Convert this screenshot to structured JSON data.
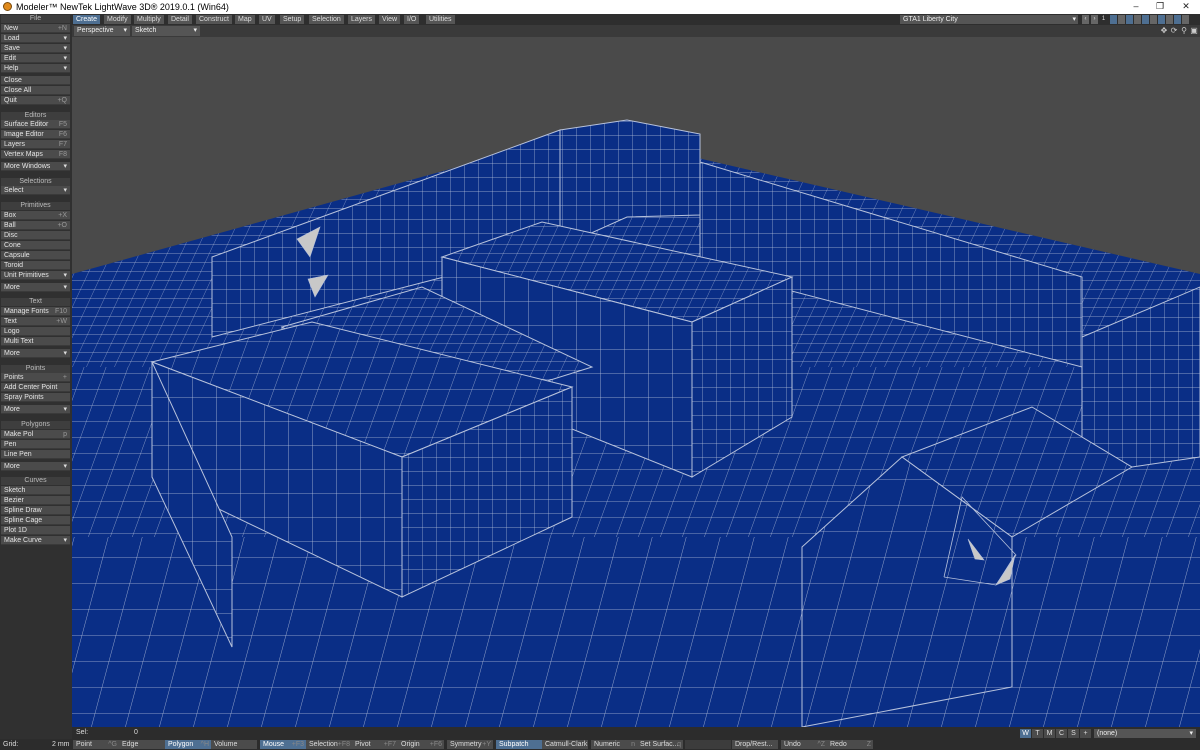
{
  "window": {
    "title": "Modeler™ NewTek LightWave 3D® 2019.0.1 (Win64)",
    "controls": [
      "–",
      "❐",
      "✕"
    ]
  },
  "menu_tabs": [
    "Create",
    "Modify",
    "Multiply",
    "Detail",
    "Construct",
    "Map",
    "UV",
    "Setup",
    "Selection",
    "Layers",
    "View",
    "I/O",
    "Utilities"
  ],
  "active_tab": "Create",
  "layer_select": {
    "value": "GTA1 Liberty City",
    "arrow": "▾"
  },
  "layer_nav": {
    "prev": "‹",
    "next": "›",
    "number": "1"
  },
  "viewport_header": {
    "view": "Perspective",
    "mode": "Sketch",
    "arrow": "▾"
  },
  "viewport_icons": [
    "move-view-icon",
    "rotate-view-icon",
    "zoom-view-icon",
    "maximize-view-icon"
  ],
  "sidebar": {
    "file": {
      "header": "File",
      "items": [
        {
          "label": "New",
          "shortcut": "+N"
        },
        {
          "label": "Load",
          "arrow": "▾"
        },
        {
          "label": "Save",
          "arrow": "▾"
        },
        {
          "label": "Edit",
          "arrow": "▾"
        },
        {
          "label": "Help",
          "arrow": "▾"
        },
        {
          "label": "Close"
        },
        {
          "label": "Close All"
        },
        {
          "label": "Quit",
          "shortcut": "+Q"
        }
      ]
    },
    "editors": {
      "header": "Editors",
      "items": [
        {
          "label": "Surface Editor",
          "shortcut": "F5"
        },
        {
          "label": "Image Editor",
          "shortcut": "F6"
        },
        {
          "label": "Layers",
          "shortcut": "F7"
        },
        {
          "label": "Vertex Maps",
          "shortcut": "F8"
        },
        {
          "label": "More Windows",
          "arrow": "▾"
        }
      ]
    },
    "selections": {
      "header": "Selections",
      "items": [
        {
          "label": "Select",
          "arrow": "▾"
        }
      ]
    },
    "primitives": {
      "header": "Primitives",
      "items": [
        {
          "label": "Box",
          "shortcut": "+X"
        },
        {
          "label": "Ball",
          "shortcut": "+O"
        },
        {
          "label": "Disc"
        },
        {
          "label": "Cone"
        },
        {
          "label": "Capsule"
        },
        {
          "label": "Toroid"
        },
        {
          "label": "Unit Primitives",
          "arrow": "▾"
        },
        {
          "label": "More",
          "arrow": "▾"
        }
      ]
    },
    "text": {
      "header": "Text",
      "items": [
        {
          "label": "Manage Fonts",
          "shortcut": "F10"
        },
        {
          "label": "Text",
          "shortcut": "+W"
        },
        {
          "label": "Logo"
        },
        {
          "label": "Multi Text"
        },
        {
          "label": "More",
          "arrow": "▾"
        }
      ]
    },
    "points": {
      "header": "Points",
      "items": [
        {
          "label": "Points",
          "shortcut": "+"
        },
        {
          "label": "Add Center Point"
        },
        {
          "label": "Spray Points"
        },
        {
          "label": "More",
          "arrow": "▾"
        }
      ]
    },
    "polygons": {
      "header": "Polygons",
      "items": [
        {
          "label": "Make Pol",
          "shortcut": "p"
        },
        {
          "label": "Pen"
        },
        {
          "label": "Line Pen"
        },
        {
          "label": "More",
          "arrow": "▾"
        }
      ]
    },
    "curves": {
      "header": "Curves",
      "items": [
        {
          "label": "Sketch"
        },
        {
          "label": "Bezier"
        },
        {
          "label": "Spline Draw"
        },
        {
          "label": "Spline Cage"
        },
        {
          "label": "Plot 1D"
        },
        {
          "label": "Make Curve",
          "arrow": "▾"
        }
      ]
    }
  },
  "status": {
    "sel_label": "Sel:",
    "sel_value": "0",
    "view_buttons": [
      "W",
      "T",
      "M",
      "C",
      "S",
      "+"
    ],
    "none_select": "(none)",
    "arrow": "▾"
  },
  "bottom": {
    "grid_label": "Grid:",
    "grid_value": "2 mm",
    "buttons": [
      {
        "label": "Point",
        "shortcut": "^G"
      },
      {
        "label": "Edge",
        "shortcut": ""
      },
      {
        "label": "Polygon",
        "shortcut": "^H",
        "active": true
      },
      {
        "label": "Volume",
        "shortcut": ""
      },
      {
        "label": "Mouse",
        "shortcut": "+F3",
        "active": true
      },
      {
        "label": "Selection",
        "shortcut": "+F8"
      },
      {
        "label": "Pivot",
        "shortcut": "+F7"
      },
      {
        "label": "Origin",
        "shortcut": "+F6"
      },
      {
        "label": "Symmetry",
        "shortcut": "+Y"
      },
      {
        "label": "Subpatch",
        "shortcut": "",
        "active": true
      },
      {
        "label": "Catmull-Clark",
        "shortcut": ""
      },
      {
        "label": "Numeric",
        "shortcut": "n"
      },
      {
        "label": "Set Surfac...",
        "shortcut": "q"
      },
      {
        "label": "",
        "shortcut": ""
      },
      {
        "label": "Drop/Rest...",
        "shortcut": ""
      },
      {
        "label": "Undo",
        "shortcut": "^Z"
      },
      {
        "label": "Redo",
        "shortcut": "Z"
      }
    ]
  },
  "colors": {
    "mesh_fill": "#0a2e86",
    "wire": "#b7c2dc",
    "background": "#4a4a4a",
    "accent": "#4e6f92"
  }
}
